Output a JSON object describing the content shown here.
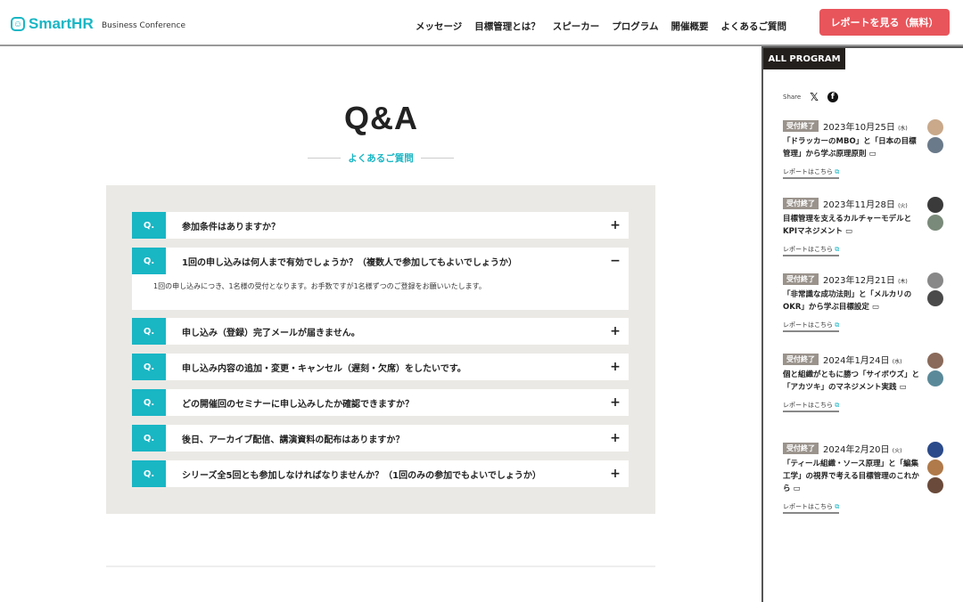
{
  "header": {
    "logo": "SmartHR",
    "logo_sub": "Business Conference",
    "nav": [
      "メッセージ",
      "目標管理とは？",
      "スピーカー",
      "プログラム",
      "開催概要",
      "よくあるご質問"
    ],
    "cta": "レポートを見る（無料）"
  },
  "main": {
    "title": "Q&A",
    "subtitle": "よくあるご質問",
    "q_mark": "Q.",
    "items": [
      {
        "q": "参加条件はありますか？",
        "toggle": "+"
      },
      {
        "q": "1回の申し込みは何人まで有効でしょうか？（複数人で参加してもよいでしょうか）",
        "toggle": "−",
        "a": "1回の申し込みにつき、1名様の受付となります。お手数ですが1名様ずつのご登録をお願いいたします。"
      },
      {
        "q": "申し込み（登録）完了メールが届きません。",
        "toggle": "+"
      },
      {
        "q": "申し込み内容の追加・変更・キャンセル（遅刻・欠席）をしたいです。",
        "toggle": "+"
      },
      {
        "q": "どの開催回のセミナーに申し込みしたか確認できますか？",
        "toggle": "+"
      },
      {
        "q": "後日、アーカイブ配信、講演資料の配布はありますか？",
        "toggle": "+"
      },
      {
        "q": "シリーズ全5回とも参加しなければなりませんか？（1回のみの参加でもよいでしょうか）",
        "toggle": "+"
      }
    ]
  },
  "sidebar": {
    "tab": "ALL PROGRAM",
    "share": "Share",
    "x_icon": "𝕏",
    "fb_icon": "f",
    "programs": [
      {
        "badge": "受付終了",
        "date": "2023年10月25日",
        "dow": "(水)",
        "title": "「ドラッカーのMBO」と「日本の目標管理」から学ぶ原理原則 ▭",
        "link": "レポートはこちら",
        "avatars": [
          "#c9a98a",
          "#6a7a8a"
        ]
      },
      {
        "badge": "受付終了",
        "date": "2023年11月28日",
        "dow": "(火)",
        "title": "目標管理を支えるカルチャーモデルとKPIマネジメント ▭",
        "link": "レポートはこちら",
        "avatars": [
          "#3a3a3a",
          "#7a8a7a"
        ]
      },
      {
        "badge": "受付終了",
        "date": "2023年12月21日",
        "dow": "(木)",
        "title": "「非常識な成功法則」と「メルカリのOKR」から学ぶ目標設定 ▭",
        "link": "レポートはこちら",
        "avatars": [
          "#888",
          "#4a4a4a"
        ]
      },
      {
        "badge": "受付終了",
        "date": "2024年1月24日",
        "dow": "(水)",
        "title": "個と組織がともに勝つ「サイボウズ」と「アカツキ」のマネジメント実践 ▭",
        "link": "レポートはこちら",
        "avatars": [
          "#8a6a5a",
          "#5a8a9a"
        ]
      },
      {
        "badge": "受付終了",
        "date": "2024年2月20日",
        "dow": "(火)",
        "title": "「ティール組織・ソース原理」と「編集工学」の視界で考える目標管理のこれから ▭",
        "link": "レポートはこちら",
        "avatars": [
          "#2a4a8a",
          "#b07a4a",
          "#6a4a3a"
        ]
      }
    ]
  }
}
